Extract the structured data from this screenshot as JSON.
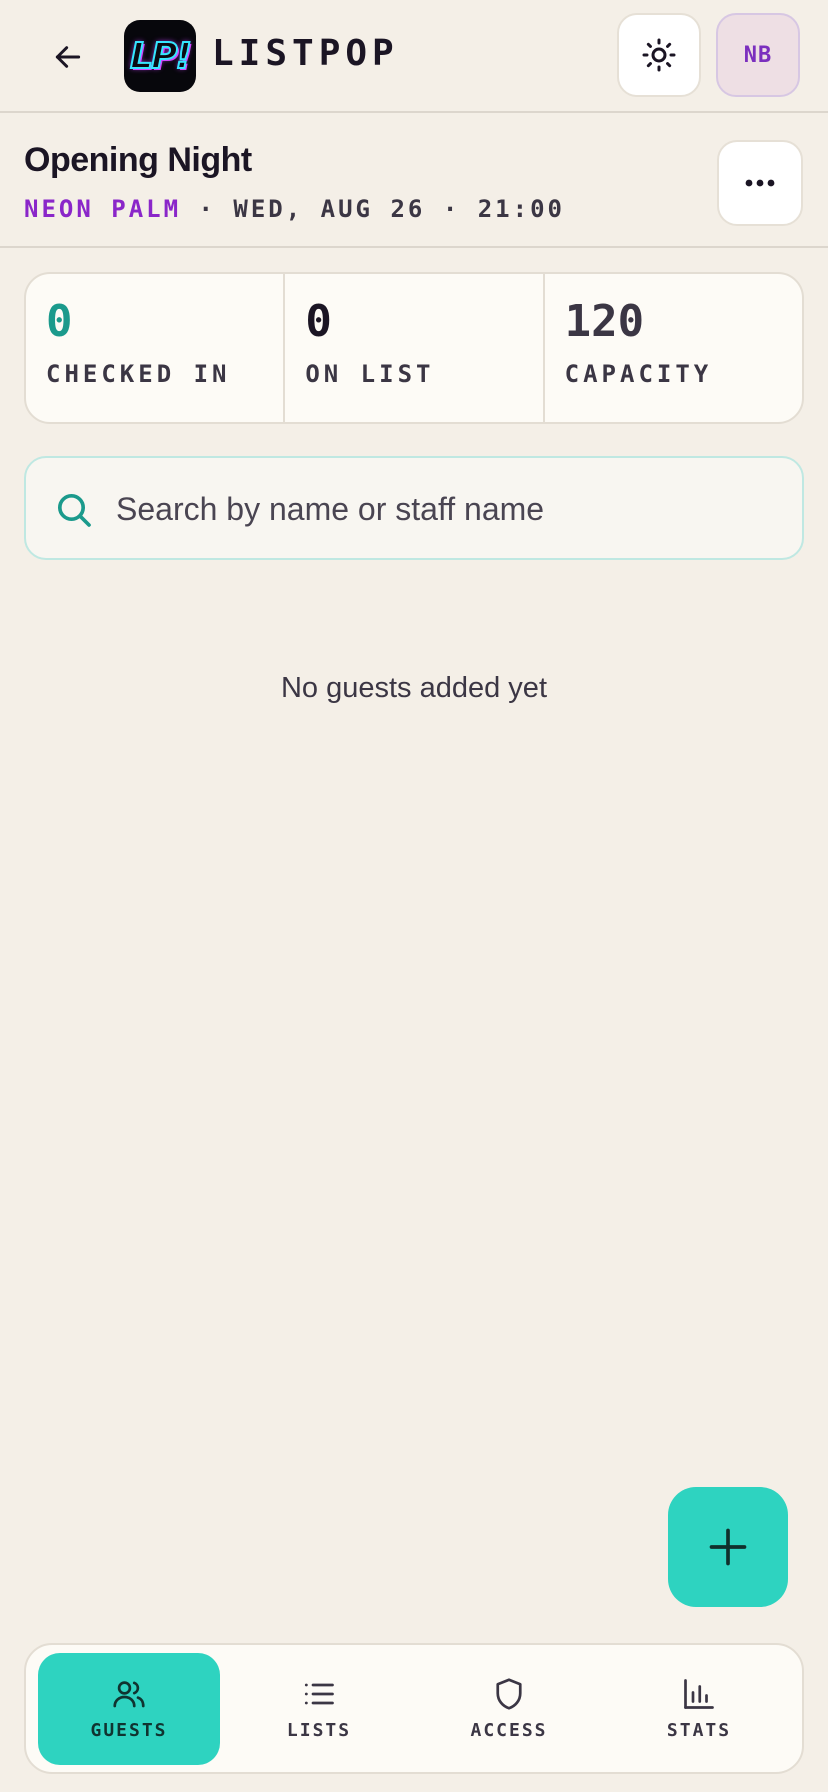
{
  "app": {
    "brand_name": "LISTPOP",
    "logo_text": "LP!",
    "avatar_initials": "NB"
  },
  "event": {
    "title": "Opening Night",
    "venue": "NEON PALM",
    "separator": "·",
    "date": "WED, AUG 26",
    "time": "21:00"
  },
  "stats": [
    {
      "value": "0",
      "label": "CHECKED IN"
    },
    {
      "value": "0",
      "label": "ON LIST"
    },
    {
      "value": "120",
      "label": "CAPACITY"
    }
  ],
  "search": {
    "placeholder": "Search by name or staff name",
    "value": ""
  },
  "empty_state": "No guests added yet",
  "nav": {
    "items": [
      {
        "label": "GUESTS",
        "icon": "users-icon",
        "active": true
      },
      {
        "label": "LISTS",
        "icon": "list-icon",
        "active": false
      },
      {
        "label": "ACCESS",
        "icon": "shield-icon",
        "active": false
      },
      {
        "label": "STATS",
        "icon": "bar-chart-icon",
        "active": false
      }
    ]
  },
  "icons": {
    "back": "arrow-left-icon",
    "theme": "sun-icon",
    "more": "more-horizontal-icon",
    "search": "search-icon",
    "fab": "plus-icon"
  },
  "colors": {
    "background": "#f4efe7",
    "accent_teal": "#2ed3c0",
    "teal_text": "#1b9a8c",
    "venue_purple": "#8a26c9",
    "text_dark": "#1b1524"
  }
}
